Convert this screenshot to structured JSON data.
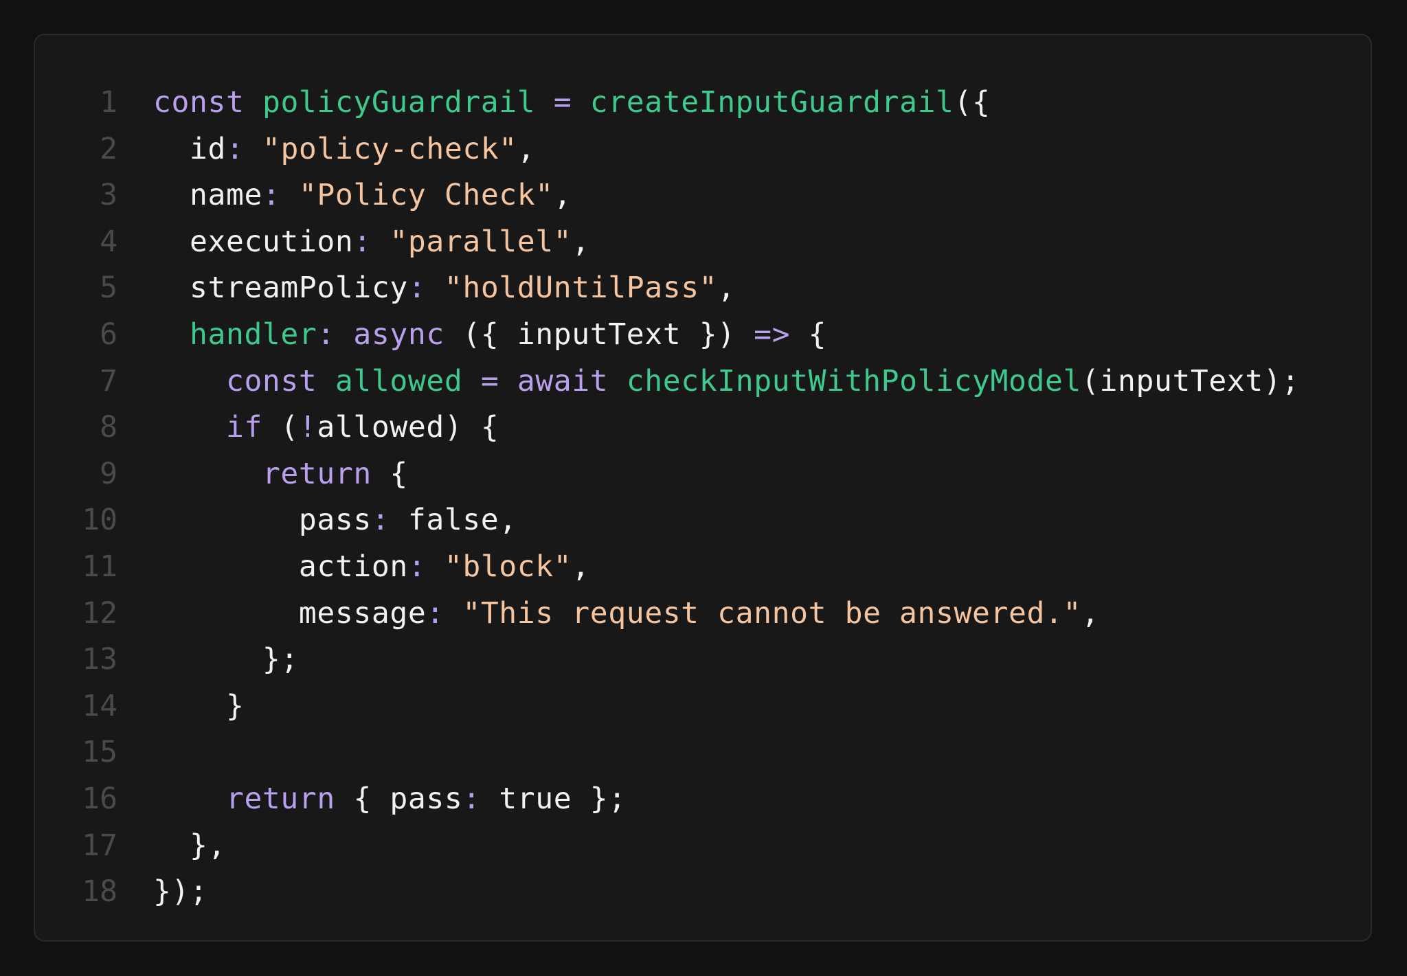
{
  "colors": {
    "background": "#111112",
    "panel": "#181818",
    "panel_border": "#2a2a2a",
    "line_number": "#4a4a4a",
    "keyword": "#b9a0ee",
    "function": "#3ec98d",
    "string": "#f5c5a0",
    "text": "#f2f2f2"
  },
  "code": {
    "lines": [
      {
        "number": "1",
        "tokens": [
          {
            "t": "const",
            "k": "kw"
          },
          {
            "t": " ",
            "k": "plain"
          },
          {
            "t": "policyGuardrail",
            "k": "fn"
          },
          {
            "t": " ",
            "k": "plain"
          },
          {
            "t": "=",
            "k": "op"
          },
          {
            "t": " ",
            "k": "plain"
          },
          {
            "t": "createInputGuardrail",
            "k": "fn"
          },
          {
            "t": "({",
            "k": "punct"
          }
        ]
      },
      {
        "number": "2",
        "tokens": [
          {
            "t": "  id",
            "k": "prop"
          },
          {
            "t": ":",
            "k": "op"
          },
          {
            "t": " ",
            "k": "plain"
          },
          {
            "t": "\"policy-check\"",
            "k": "str"
          },
          {
            "t": ",",
            "k": "punct"
          }
        ]
      },
      {
        "number": "3",
        "tokens": [
          {
            "t": "  name",
            "k": "prop"
          },
          {
            "t": ":",
            "k": "op"
          },
          {
            "t": " ",
            "k": "plain"
          },
          {
            "t": "\"Policy Check\"",
            "k": "str"
          },
          {
            "t": ",",
            "k": "punct"
          }
        ]
      },
      {
        "number": "4",
        "tokens": [
          {
            "t": "  execution",
            "k": "prop"
          },
          {
            "t": ":",
            "k": "op"
          },
          {
            "t": " ",
            "k": "plain"
          },
          {
            "t": "\"parallel\"",
            "k": "str"
          },
          {
            "t": ",",
            "k": "punct"
          }
        ]
      },
      {
        "number": "5",
        "tokens": [
          {
            "t": "  streamPolicy",
            "k": "prop"
          },
          {
            "t": ":",
            "k": "op"
          },
          {
            "t": " ",
            "k": "plain"
          },
          {
            "t": "\"holdUntilPass\"",
            "k": "str"
          },
          {
            "t": ",",
            "k": "punct"
          }
        ]
      },
      {
        "number": "6",
        "tokens": [
          {
            "t": "  ",
            "k": "plain"
          },
          {
            "t": "handler",
            "k": "fn"
          },
          {
            "t": ":",
            "k": "op"
          },
          {
            "t": " ",
            "k": "plain"
          },
          {
            "t": "async",
            "k": "kw"
          },
          {
            "t": " ({ inputText }) ",
            "k": "plain"
          },
          {
            "t": "=>",
            "k": "op"
          },
          {
            "t": " {",
            "k": "punct"
          }
        ]
      },
      {
        "number": "7",
        "tokens": [
          {
            "t": "    ",
            "k": "plain"
          },
          {
            "t": "const",
            "k": "kw"
          },
          {
            "t": " ",
            "k": "plain"
          },
          {
            "t": "allowed",
            "k": "fn"
          },
          {
            "t": " ",
            "k": "plain"
          },
          {
            "t": "=",
            "k": "op"
          },
          {
            "t": " ",
            "k": "plain"
          },
          {
            "t": "await",
            "k": "kw"
          },
          {
            "t": " ",
            "k": "plain"
          },
          {
            "t": "checkInputWithPolicyModel",
            "k": "fn"
          },
          {
            "t": "(inputText);",
            "k": "punct"
          }
        ]
      },
      {
        "number": "8",
        "tokens": [
          {
            "t": "    ",
            "k": "plain"
          },
          {
            "t": "if",
            "k": "kw"
          },
          {
            "t": " (",
            "k": "punct"
          },
          {
            "t": "!",
            "k": "op"
          },
          {
            "t": "allowed) {",
            "k": "punct"
          }
        ]
      },
      {
        "number": "9",
        "tokens": [
          {
            "t": "      ",
            "k": "plain"
          },
          {
            "t": "return",
            "k": "kw"
          },
          {
            "t": " {",
            "k": "punct"
          }
        ]
      },
      {
        "number": "10",
        "tokens": [
          {
            "t": "        pass",
            "k": "prop"
          },
          {
            "t": ":",
            "k": "op"
          },
          {
            "t": " false,",
            "k": "plain"
          }
        ]
      },
      {
        "number": "11",
        "tokens": [
          {
            "t": "        action",
            "k": "prop"
          },
          {
            "t": ":",
            "k": "op"
          },
          {
            "t": " ",
            "k": "plain"
          },
          {
            "t": "\"block\"",
            "k": "str"
          },
          {
            "t": ",",
            "k": "punct"
          }
        ]
      },
      {
        "number": "12",
        "tokens": [
          {
            "t": "        message",
            "k": "prop"
          },
          {
            "t": ":",
            "k": "op"
          },
          {
            "t": " ",
            "k": "plain"
          },
          {
            "t": "\"This request cannot be answered.\"",
            "k": "str"
          },
          {
            "t": ",",
            "k": "punct"
          }
        ]
      },
      {
        "number": "13",
        "tokens": [
          {
            "t": "      };",
            "k": "punct"
          }
        ]
      },
      {
        "number": "14",
        "tokens": [
          {
            "t": "    }",
            "k": "punct"
          }
        ]
      },
      {
        "number": "15",
        "tokens": []
      },
      {
        "number": "16",
        "tokens": [
          {
            "t": "    ",
            "k": "plain"
          },
          {
            "t": "return",
            "k": "kw"
          },
          {
            "t": " { pass",
            "k": "plain"
          },
          {
            "t": ":",
            "k": "op"
          },
          {
            "t": " true };",
            "k": "plain"
          }
        ]
      },
      {
        "number": "17",
        "tokens": [
          {
            "t": "  },",
            "k": "punct"
          }
        ]
      },
      {
        "number": "18",
        "tokens": [
          {
            "t": "});",
            "k": "punct"
          }
        ]
      }
    ]
  }
}
